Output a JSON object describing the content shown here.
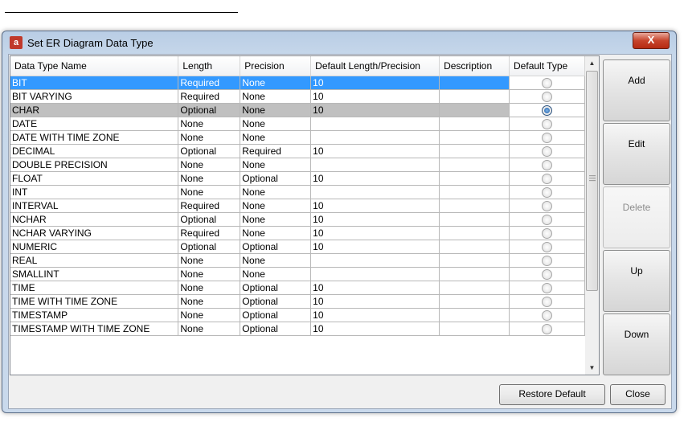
{
  "window": {
    "title": "Set ER Diagram Data Type",
    "close_label": "X"
  },
  "table": {
    "columns": [
      "Data Type Name",
      "Length",
      "Precision",
      "Default Length/Precision",
      "Description",
      "Default Type"
    ],
    "rows": [
      {
        "name": "BIT",
        "length": "Required",
        "precision": "None",
        "default": "10",
        "description": "",
        "default_type": false
      },
      {
        "name": "BIT VARYING",
        "length": "Required",
        "precision": "None",
        "default": "10",
        "description": "",
        "default_type": false
      },
      {
        "name": "CHAR",
        "length": "Optional",
        "precision": "None",
        "default": "10",
        "description": "",
        "default_type": true
      },
      {
        "name": "DATE",
        "length": "None",
        "precision": "None",
        "default": "",
        "description": "",
        "default_type": false
      },
      {
        "name": "DATE WITH TIME ZONE",
        "length": "None",
        "precision": "None",
        "default": "",
        "description": "",
        "default_type": false
      },
      {
        "name": "DECIMAL",
        "length": "Optional",
        "precision": "Required",
        "default": "10",
        "description": "",
        "default_type": false
      },
      {
        "name": "DOUBLE PRECISION",
        "length": "None",
        "precision": "None",
        "default": "",
        "description": "",
        "default_type": false
      },
      {
        "name": "FLOAT",
        "length": "None",
        "precision": "Optional",
        "default": "10",
        "description": "",
        "default_type": false
      },
      {
        "name": "INT",
        "length": "None",
        "precision": "None",
        "default": "",
        "description": "",
        "default_type": false
      },
      {
        "name": "INTERVAL",
        "length": "Required",
        "precision": "None",
        "default": "10",
        "description": "",
        "default_type": false
      },
      {
        "name": "NCHAR",
        "length": "Optional",
        "precision": "None",
        "default": "10",
        "description": "",
        "default_type": false
      },
      {
        "name": "NCHAR VARYING",
        "length": "Required",
        "precision": "None",
        "default": "10",
        "description": "",
        "default_type": false
      },
      {
        "name": "NUMERIC",
        "length": "Optional",
        "precision": "Optional",
        "default": "10",
        "description": "",
        "default_type": false
      },
      {
        "name": "REAL",
        "length": "None",
        "precision": "None",
        "default": "",
        "description": "",
        "default_type": false
      },
      {
        "name": "SMALLINT",
        "length": "None",
        "precision": "None",
        "default": "",
        "description": "",
        "default_type": false
      },
      {
        "name": "TIME",
        "length": "None",
        "precision": "Optional",
        "default": "10",
        "description": "",
        "default_type": false
      },
      {
        "name": "TIME WITH TIME ZONE",
        "length": "None",
        "precision": "Optional",
        "default": "10",
        "description": "",
        "default_type": false
      },
      {
        "name": "TIMESTAMP",
        "length": "None",
        "precision": "Optional",
        "default": "10",
        "description": "",
        "default_type": false
      },
      {
        "name": "TIMESTAMP WITH TIME ZONE",
        "length": "None",
        "precision": "Optional",
        "default": "10",
        "description": "",
        "default_type": false
      }
    ],
    "selected_row": 0,
    "highlighted_row": 2
  },
  "side_buttons": {
    "add": "Add",
    "edit": "Edit",
    "delete": "Delete",
    "up": "Up",
    "down": "Down"
  },
  "bottom_buttons": {
    "restore": "Restore Default",
    "close": "Close"
  },
  "colors": {
    "selection": "#3399ff",
    "highlight": "#c0c0c0",
    "close_button": "#c7442c"
  }
}
